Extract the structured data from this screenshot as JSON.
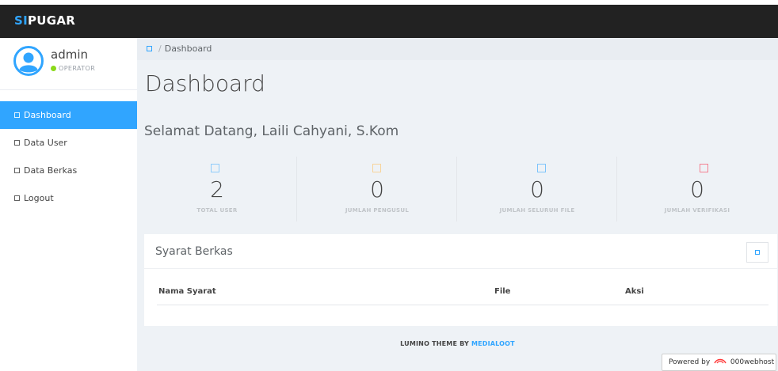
{
  "brand": {
    "prefix": "SI",
    "suffix": "PUGAR"
  },
  "profile": {
    "name": "admin",
    "role": "OPERATOR",
    "status_color": "#8ad919"
  },
  "sidebar": {
    "items": [
      {
        "label": "Dashboard",
        "active": true,
        "icon": "square-icon"
      },
      {
        "label": "Data User",
        "active": false,
        "icon": "square-icon"
      },
      {
        "label": "Data Berkas",
        "active": false,
        "icon": "square-icon"
      },
      {
        "label": "Logout",
        "active": false,
        "icon": "square-icon"
      }
    ]
  },
  "breadcrumb": {
    "home_icon": "home-icon",
    "separator": "/",
    "current": "Dashboard"
  },
  "page": {
    "title": "Dashboard",
    "welcome": "Selamat Datang, Laili Cahyani, S.Kom"
  },
  "stats": [
    {
      "value": "2",
      "label": "TOTAL USER",
      "color": "#30a5ff"
    },
    {
      "value": "0",
      "label": "JUMLAH PENGUSUL",
      "color": "#ffb53e"
    },
    {
      "value": "0",
      "label": "JUMLAH SELURUH FILE",
      "color": "#1ebfae"
    },
    {
      "value": "0",
      "label": "JUMLAH VERIFIKASI",
      "color": "#f9243f"
    }
  ],
  "panel": {
    "title": "Syarat Berkas",
    "columns": [
      "Nama Syarat",
      "File",
      "Aksi"
    ]
  },
  "footer": {
    "credit_text": "LUMINO THEME BY ",
    "credit_link": "MEDIALOOT"
  },
  "powered": {
    "prefix": "Powered by",
    "brand": "000webhost"
  },
  "colors": {
    "accent": "#30a5ff",
    "topbar": "#222222"
  }
}
